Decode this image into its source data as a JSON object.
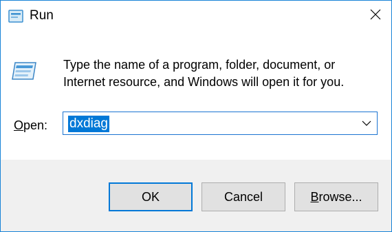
{
  "window": {
    "title": "Run",
    "title_icon": "run-dialog-icon",
    "close_icon": "close-icon"
  },
  "body": {
    "icon": "run-program-icon",
    "description": "Type the name of a program, folder, document, or Internet resource, and Windows will open it for you.",
    "open_label_mnemonic": "O",
    "open_label_rest": "pen:",
    "open_value": "dxdiag",
    "dropdown_icon": "chevron-down-icon"
  },
  "buttons": {
    "ok_label": "OK",
    "cancel_label": "Cancel",
    "browse_mnemonic": "B",
    "browse_rest": "rowse..."
  },
  "colors": {
    "accent": "#0078d7",
    "footer_bg": "#f0f0f0",
    "button_bg": "#e1e1e1"
  }
}
